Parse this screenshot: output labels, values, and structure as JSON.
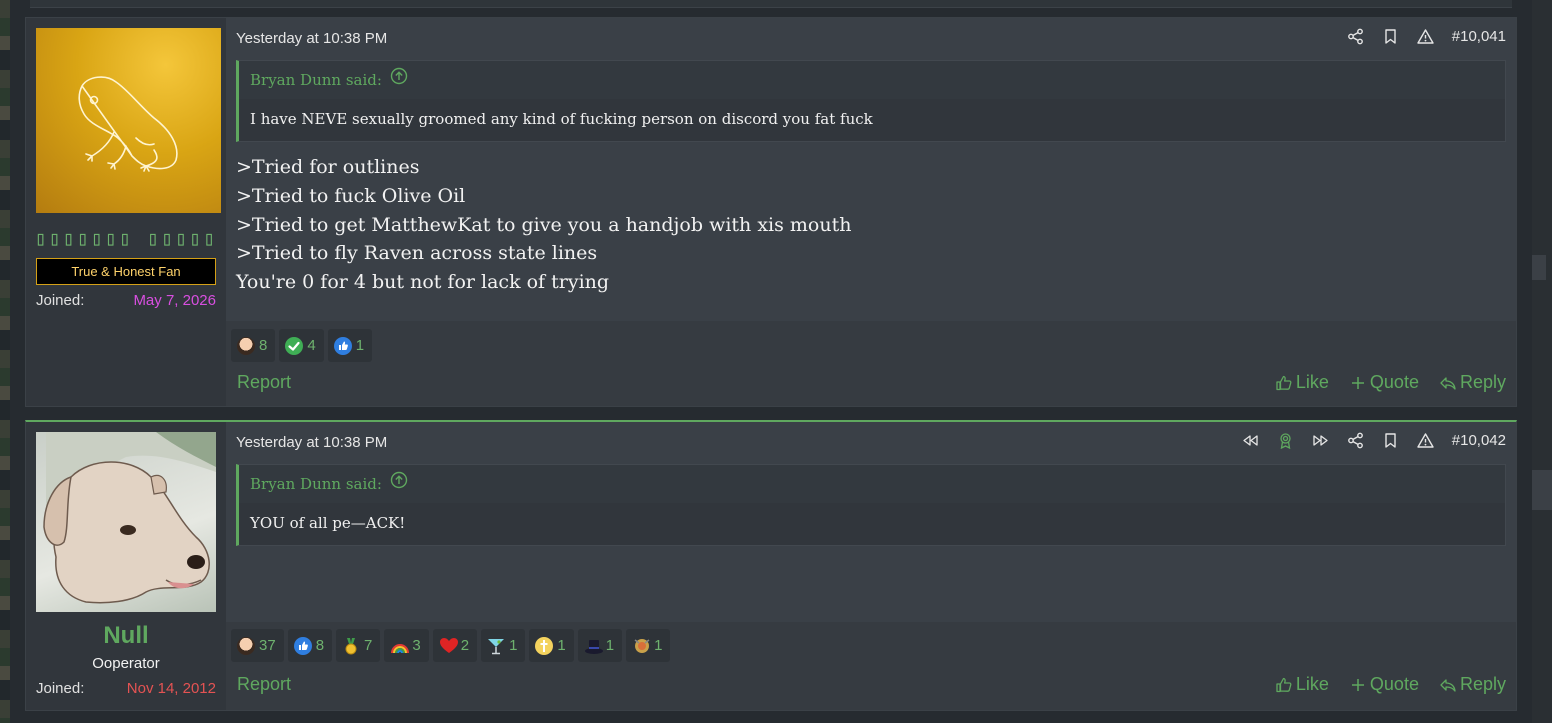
{
  "posts": [
    {
      "user": {
        "name": "▯▯▯▯▯▯▯ ▯▯▯▯▯",
        "banner": "True & Honest Fan",
        "joined_label": "Joined:",
        "joined_date": "May 7, 2026"
      },
      "date": "Yesterday at 10:38 PM",
      "post_number": "#10,041",
      "quote": {
        "author": "Bryan Dunn said:",
        "text": "I have NEVE sexually groomed any kind of fucking person on discord you fat fuck"
      },
      "message_lines": [
        ">Tried for outlines",
        ">Tried to fuck Olive Oil",
        ">Tried to get MatthewKat to give you a handjob with xis mouth",
        ">Tried to fly Raven across state lines",
        "You're 0 for 4 but not for lack of trying"
      ],
      "reactions": [
        {
          "icon": "face-emoji-icon",
          "count": "8"
        },
        {
          "icon": "check-icon",
          "count": "4"
        },
        {
          "icon": "thumbs-up-icon",
          "count": "1"
        }
      ],
      "report": "Report",
      "like": "Like",
      "quote_label": "Quote",
      "reply": "Reply"
    },
    {
      "user": {
        "name": "Null",
        "title": "Ooperator",
        "joined_label": "Joined:",
        "joined_date": "Nov 14, 2012"
      },
      "date": "Yesterday at 10:38 PM",
      "post_number": "#10,042",
      "quote": {
        "author": "Bryan Dunn said:",
        "text": "YOU of all pe—ACK!"
      },
      "reactions": [
        {
          "icon": "face-emoji-icon",
          "count": "37"
        },
        {
          "icon": "thumbs-up-icon",
          "count": "8"
        },
        {
          "icon": "medal-icon",
          "count": "7"
        },
        {
          "icon": "rainbow-icon",
          "count": "3"
        },
        {
          "icon": "heart-icon",
          "count": "2"
        },
        {
          "icon": "cocktail-icon",
          "count": "1"
        },
        {
          "icon": "cross-icon",
          "count": "1"
        },
        {
          "icon": "top-hat-icon",
          "count": "1"
        },
        {
          "icon": "crest-icon",
          "count": "1"
        }
      ],
      "report": "Report",
      "like": "Like",
      "quote_label": "Quote",
      "reply": "Reply"
    }
  ],
  "colors": {
    "accent_green": "#5fa85f",
    "joined_pink": "#d84fe0",
    "joined_red": "#e45353",
    "banner_gold": "#d4a017"
  }
}
